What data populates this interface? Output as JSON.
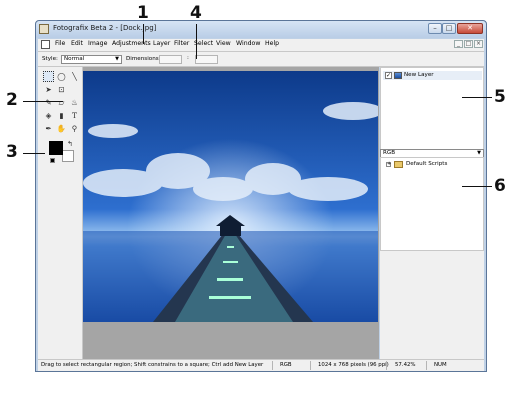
{
  "window": {
    "title": "Fotografix Beta 2 - [Dock.jpg]",
    "controls": {
      "minimize": "–",
      "maximize": "□",
      "close": "✕"
    }
  },
  "menubar": {
    "items": [
      "File",
      "Edit",
      "Image",
      "Adjustments",
      "Layer",
      "Filter",
      "Select",
      "View",
      "Window",
      "Help"
    ],
    "mdi_controls": [
      "_",
      "□",
      "×"
    ]
  },
  "options_bar": {
    "style_label": "Style:",
    "style_value": "Normal",
    "dimensions_label": "Dimensions:",
    "dimensions_separator": ":"
  },
  "tools": {
    "icons": [
      "rect-select-icon",
      "ellipse-select-icon",
      "line-icon",
      "move-icon",
      "crop-icon",
      "pencil-icon",
      "eraser-icon",
      "brush-icon",
      "fill-icon",
      "gradient-icon",
      "text-icon",
      "eyedropper-icon",
      "hand-icon",
      "zoom-icon"
    ],
    "swap_glyph": "↰"
  },
  "colors": {
    "foreground": "#000000",
    "background": "#ffffff",
    "canvas_bg": "#a5a5a5",
    "chrome": "#f0f0f0"
  },
  "layers_panel": {
    "layer_name": "New Layer",
    "visible": true
  },
  "mode_select": {
    "value": "RGB"
  },
  "scripts_panel": {
    "expand_glyph": "+",
    "folder_name": "Default Scripts"
  },
  "statusbar": {
    "hint": "Drag to select rectangular region; Shift constrains to a square; Ctrl add New Layer",
    "mode": "RGB",
    "dimensions": "1024 x 768 pixels (96 ppi)",
    "zoom": "57.42%",
    "numlock": "NUM"
  },
  "callouts": [
    "1",
    "2",
    "3",
    "4",
    "5",
    "6"
  ]
}
